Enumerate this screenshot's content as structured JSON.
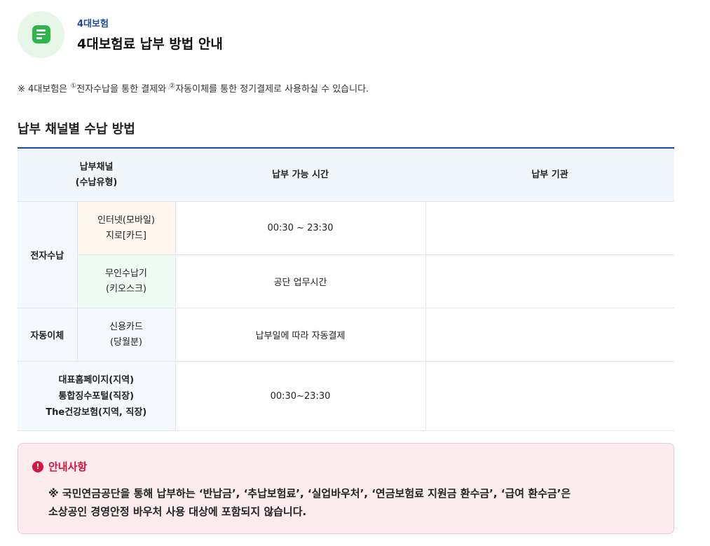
{
  "header": {
    "category": "4대보험",
    "title": "4대보험료 납부 방법 안내",
    "logo_icon": "document-list-icon"
  },
  "intro": {
    "prefix": "※ 4대보험은 ",
    "mark1": "①",
    "part1": "전자수납을 통한 결제와 ",
    "mark2": "②",
    "part2": "자동이체를 통한 정기결제로 사용하실 수 있습니다."
  },
  "section_title": "납부 채널별 수납 방법",
  "table": {
    "col_channel_line1": "납부채널",
    "col_channel_line2": "(수납유형)",
    "col_time": "납부 가능 시간",
    "col_org": "납부 기관",
    "rows": [
      {
        "group": "전자수납",
        "sub_line1": "인터넷(모바일)",
        "sub_line2": "지로[카드]",
        "time": "00:30 ~ 23:30",
        "org": ""
      },
      {
        "sub_line1": "무인수납기",
        "sub_line2": "(키오스크)",
        "time": "공단 업무시간",
        "org": ""
      },
      {
        "group": "자동이체",
        "sub_line1": "신용카드",
        "sub_line2": "(당월분)",
        "time": "납부일에 따라 자동결제",
        "org": ""
      },
      {
        "group_line1": "대표홈페이지(지역)",
        "group_line2": "통합징수포털(직장)",
        "group_line3": "The건강보험(지역, 직장)",
        "time": "00:30~23:30",
        "org": ""
      }
    ]
  },
  "notice": {
    "icon": "alert-icon",
    "icon_glyph": "!",
    "title": "안내사항",
    "line1": "※ 국민연금공단을 통해 납부하는 ‘반납금’, ‘추납보험료’, ‘실업바우처’, ‘연금보험료 지원금 환수금’, ‘급여 환수금’은",
    "line2": "소상공인 경영안정 바우처 사용 대상에 포함되지 않습니다."
  },
  "colors": {
    "accent_blue": "#1a4aa0",
    "brand_green": "#2fb54a",
    "alert_red": "#d5143f"
  }
}
